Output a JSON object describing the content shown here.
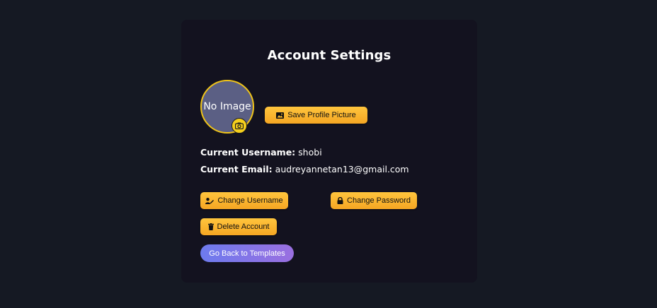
{
  "page": {
    "title": "Account Settings"
  },
  "avatar": {
    "placeholder_text": "No Image",
    "badge_icon": "camera-icon"
  },
  "buttons": {
    "save_profile_picture": "Save Profile Picture",
    "change_username": "Change Username",
    "change_password": "Change Password",
    "delete_account": "Delete Account",
    "go_back": "Go Back to Templates"
  },
  "info": {
    "username_label": "Current Username:",
    "username_value": "shobi",
    "email_label": "Current Email:",
    "email_value": "audreyannetan13@gmail.com"
  },
  "colors": {
    "page_background": "#151923",
    "card_background": "#13121f",
    "accent_button": "#f5a623",
    "avatar_border": "#f0c419",
    "back_button_gradient_start": "#6d7bee",
    "back_button_gradient_end": "#9a6fe0"
  }
}
